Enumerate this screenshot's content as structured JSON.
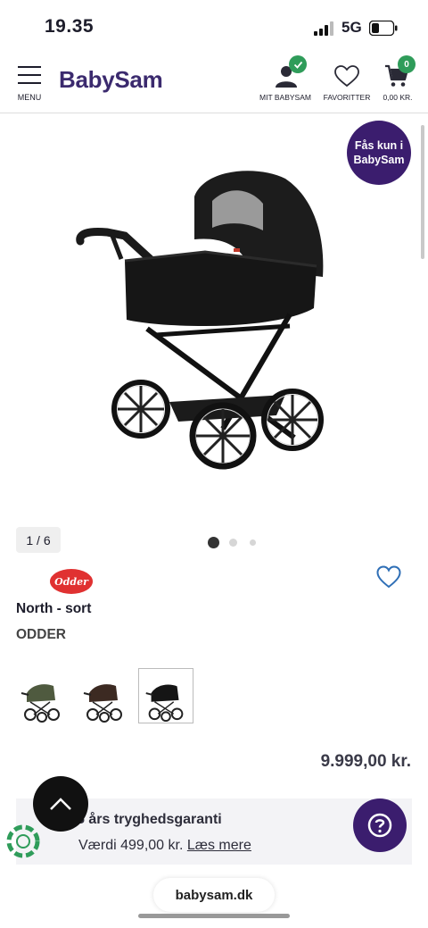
{
  "status_bar": {
    "time": "19.35",
    "network": "5G"
  },
  "header": {
    "menu_label": "MENU",
    "logo": "BabySam",
    "account_label": "MIT BABYSAM",
    "favorites_label": "FAVORITTER",
    "cart_label": "0,00 KR.",
    "cart_count": "0"
  },
  "badge": {
    "exclusive": "Fås kun i BabySam"
  },
  "gallery": {
    "counter": "1 / 6",
    "active_dot": 0
  },
  "product": {
    "brand_logo_text": "Odder",
    "title": "North - sort",
    "brand": "ODDER",
    "variants": [
      "olive",
      "brown",
      "black"
    ],
    "selected_variant": 2,
    "price": "9.999,00 kr."
  },
  "guarantee": {
    "title": "5 års tryghedsgaranti",
    "value": "Værdi 499,00 kr.",
    "link": "Læs mere"
  },
  "browser": {
    "url": "babysam.dk"
  },
  "colors": {
    "brand_purple": "#3b1d6e",
    "accent_green": "#2f9c5a",
    "heart_blue": "#2f6fb6"
  }
}
